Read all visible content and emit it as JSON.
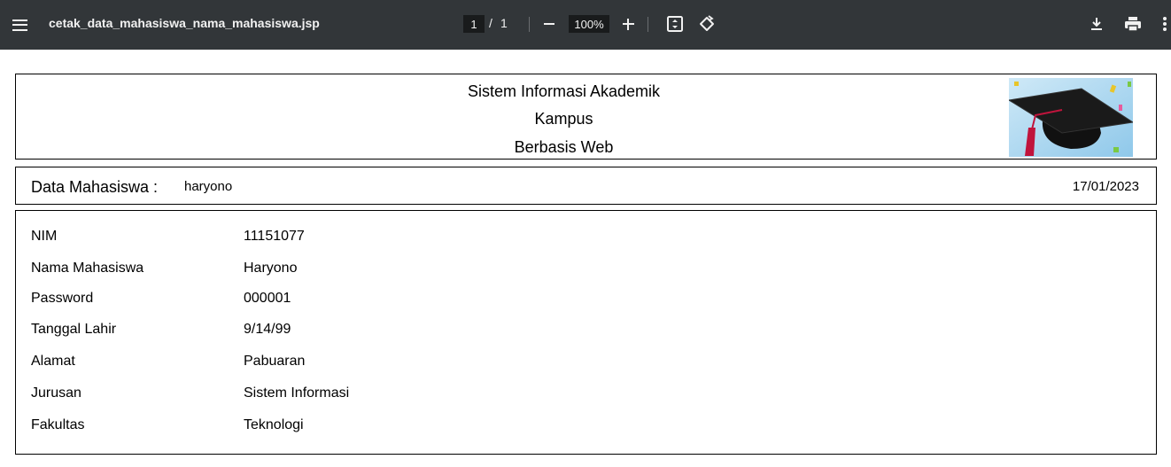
{
  "toolbar": {
    "menu_icon": "hamburger-menu-icon",
    "file_name": "cetak_data_mahasiswa_nama_mahasiswa.jsp",
    "current_page": "1",
    "page_separator": "/",
    "total_pages": "1",
    "zoom_level": "100%",
    "icons": {
      "zoom_out": "minus-icon",
      "zoom_in": "plus-icon",
      "fit": "fit-to-page-icon",
      "rotate": "rotate-icon",
      "download": "download-icon",
      "print": "print-icon",
      "more": "more-vertical-icon"
    },
    "colors": {
      "background": "#323639",
      "text": "#f1f1f1",
      "input_bg": "#191b1c"
    }
  },
  "document": {
    "header": {
      "line1": "Sistem Informasi Akademik",
      "line2": "Kampus",
      "line3": "Berbasis Web"
    },
    "title": {
      "label": "Data Mahasiswa :",
      "name": "haryono",
      "date": "17/01/2023"
    },
    "fields": [
      {
        "label": "NIM",
        "value": "11151077"
      },
      {
        "label": "Nama Mahasiswa",
        "value": "Haryono"
      },
      {
        "label": "Password",
        "value": "000001"
      },
      {
        "label": "Tanggal Lahir",
        "value": "9/14/99"
      },
      {
        "label": "Alamat",
        "value": "Pabuaran"
      },
      {
        "label": "Jurusan",
        "value": "Sistem Informasi"
      },
      {
        "label": "Fakultas",
        "value": "Teknologi"
      }
    ]
  }
}
